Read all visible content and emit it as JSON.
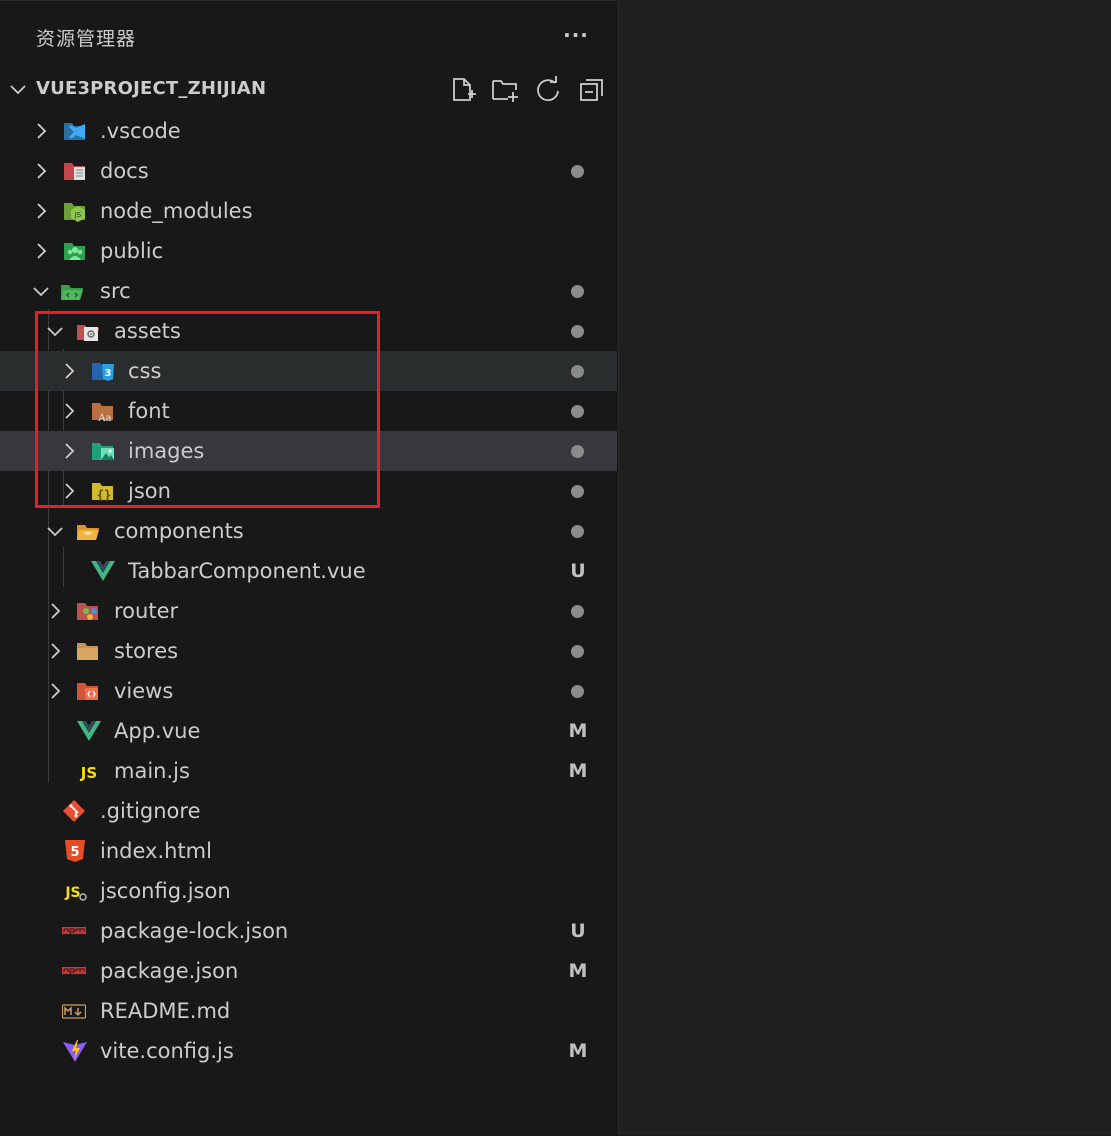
{
  "panel": {
    "title": "资源管理器",
    "more_label": "···"
  },
  "section": {
    "title": "VUE3PROJECT_ZHIJIAN",
    "actions": [
      "new-file-icon",
      "new-folder-icon",
      "refresh-icon",
      "collapse-all-icon"
    ]
  },
  "tree": {
    "items": [
      {
        "label": ".vscode",
        "icon": "vscode-folder-icon",
        "expanded": false,
        "status": ""
      },
      {
        "label": "docs",
        "icon": "docs-folder-icon",
        "expanded": false,
        "status": "dot"
      },
      {
        "label": "node_modules",
        "icon": "node-folder-icon",
        "expanded": false,
        "status": ""
      },
      {
        "label": "public",
        "icon": "public-folder-icon",
        "expanded": false,
        "status": ""
      },
      {
        "label": "src",
        "icon": "src-folder-icon",
        "expanded": true,
        "status": "dot"
      },
      {
        "label": "assets",
        "icon": "assets-folder-icon",
        "expanded": true,
        "status": "dot"
      },
      {
        "label": "css",
        "icon": "css-folder-icon",
        "expanded": false,
        "status": "dot"
      },
      {
        "label": "font",
        "icon": "font-folder-icon",
        "expanded": false,
        "status": "dot"
      },
      {
        "label": "images",
        "icon": "images-folder-icon",
        "expanded": false,
        "status": "dot"
      },
      {
        "label": "json",
        "icon": "json-folder-icon",
        "expanded": false,
        "status": "dot"
      },
      {
        "label": "components",
        "icon": "components-folder-icon",
        "expanded": true,
        "status": "dot"
      },
      {
        "label": "TabbarComponent.vue",
        "icon": "vue-file-icon",
        "status": "U"
      },
      {
        "label": "router",
        "icon": "router-folder-icon",
        "expanded": false,
        "status": "dot"
      },
      {
        "label": "stores",
        "icon": "stores-folder-icon",
        "expanded": false,
        "status": "dot"
      },
      {
        "label": "views",
        "icon": "views-folder-icon",
        "expanded": false,
        "status": "dot"
      },
      {
        "label": "App.vue",
        "icon": "vue-file-icon",
        "status": "M"
      },
      {
        "label": "main.js",
        "icon": "js-file-icon",
        "status": "M"
      },
      {
        "label": ".gitignore",
        "icon": "git-file-icon",
        "status": ""
      },
      {
        "label": "index.html",
        "icon": "html5-file-icon",
        "status": ""
      },
      {
        "label": "jsconfig.json",
        "icon": "jsconfig-file-icon",
        "status": ""
      },
      {
        "label": "package-lock.json",
        "icon": "npm-file-icon",
        "status": "U"
      },
      {
        "label": "package.json",
        "icon": "npm-file-icon",
        "status": "M"
      },
      {
        "label": "README.md",
        "icon": "markdown-file-icon",
        "status": ""
      },
      {
        "label": "vite.config.js",
        "icon": "vite-file-icon",
        "status": "M"
      }
    ]
  },
  "colors": {
    "background": "#181818",
    "editor_background": "#1f1f1f",
    "highlight_border": "#e0202a",
    "selected_row": "#2a2d2e",
    "hover_row": "#37373d"
  }
}
